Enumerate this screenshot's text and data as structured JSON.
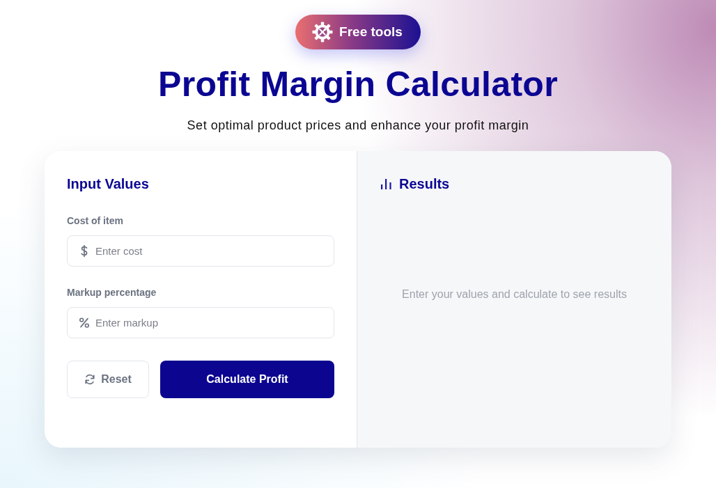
{
  "badge": {
    "label": "Free tools"
  },
  "title": "Profit Margin Calculator",
  "subtitle": "Set optimal product prices and enhance your profit margin",
  "input_panel": {
    "heading": "Input Values",
    "fields": [
      {
        "label": "Cost of item",
        "placeholder": "Enter cost",
        "kind": "currency"
      },
      {
        "label": "Markup percentage",
        "placeholder": "Enter markup",
        "kind": "percent"
      }
    ],
    "buttons": [
      {
        "label": "Reset",
        "kind": "secondary"
      },
      {
        "label": "Calculate Profit",
        "kind": "primary"
      }
    ]
  },
  "results_panel": {
    "heading": "Results",
    "empty_message": "Enter your values and calculate to see results"
  }
}
